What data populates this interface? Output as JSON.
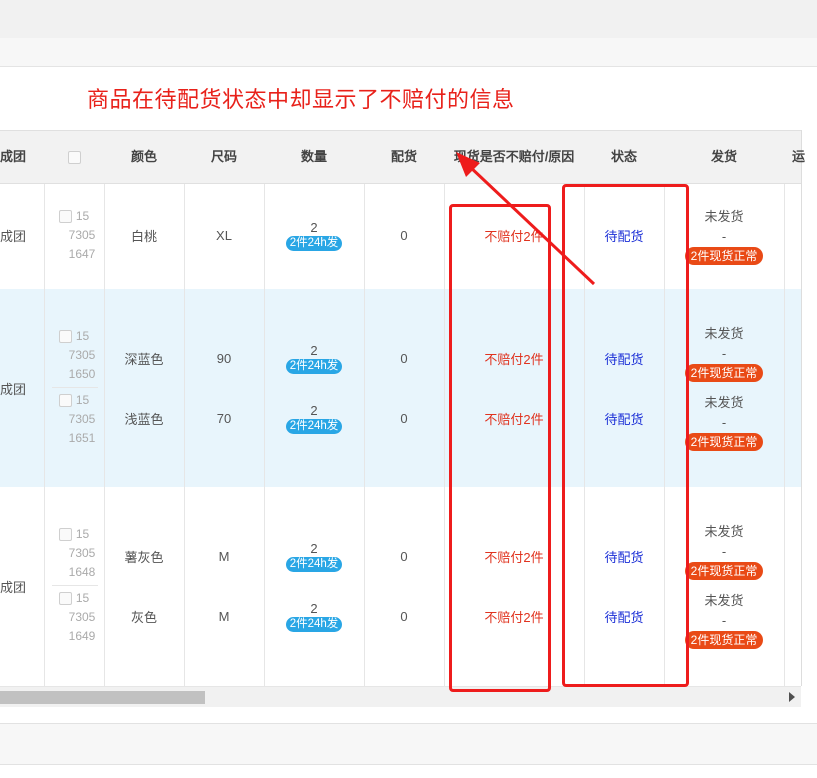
{
  "annotation": {
    "title": "商品在待配货状态中却显示了不赔付的信息"
  },
  "headers": {
    "group": "成团",
    "color": "颜色",
    "size": "尺码",
    "qty": "数量",
    "allocated": "配货",
    "nocomp": "现货是否不赔付/原因",
    "status": "状态",
    "ship": "发货",
    "extra": "运"
  },
  "rows": [
    {
      "group": "成团",
      "items": [
        {
          "id": [
            "15",
            "7305",
            "1647"
          ],
          "color": "白桃",
          "size": "XL",
          "qty": "2",
          "qty_badge": "2件24h发",
          "allocated": "0",
          "nocomp": "不赔付2件",
          "status": "待配货",
          "ship_status": "未发货",
          "ship_dash": "-",
          "ship_badge": "2件现货正常"
        }
      ]
    },
    {
      "group": "成团",
      "items": [
        {
          "id": [
            "15",
            "7305",
            "1650"
          ],
          "color": "深蓝色",
          "size": "90",
          "qty": "2",
          "qty_badge": "2件24h发",
          "allocated": "0",
          "nocomp": "不赔付2件",
          "status": "待配货",
          "ship_status": "未发货",
          "ship_dash": "-",
          "ship_badge": "2件现货正常"
        },
        {
          "id": [
            "15",
            "7305",
            "1651"
          ],
          "color": "浅蓝色",
          "size": "70",
          "qty": "2",
          "qty_badge": "2件24h发",
          "allocated": "0",
          "nocomp": "不赔付2件",
          "status": "待配货",
          "ship_status": "未发货",
          "ship_dash": "-",
          "ship_badge": "2件现货正常"
        }
      ]
    },
    {
      "group": "成团",
      "items": [
        {
          "id": [
            "15",
            "7305",
            "1648"
          ],
          "color": "薯灰色",
          "size": "M",
          "qty": "2",
          "qty_badge": "2件24h发",
          "allocated": "0",
          "nocomp": "不赔付2件",
          "status": "待配货",
          "ship_status": "未发货",
          "ship_dash": "-",
          "ship_badge": "2件现货正常"
        },
        {
          "id": [
            "15",
            "7305",
            "1649"
          ],
          "color": "灰色",
          "size": "M",
          "qty": "2",
          "qty_badge": "2件24h发",
          "allocated": "0",
          "nocomp": "不赔付2件",
          "status": "待配货",
          "ship_status": "未发货",
          "ship_dash": "-",
          "ship_badge": "2件现货正常"
        }
      ]
    }
  ],
  "colors": {
    "annotation_red": "#ee1c1c",
    "row_highlight": "#e8f5fc",
    "badge_blue": "#29a6e5",
    "badge_red": "#e94a16"
  }
}
